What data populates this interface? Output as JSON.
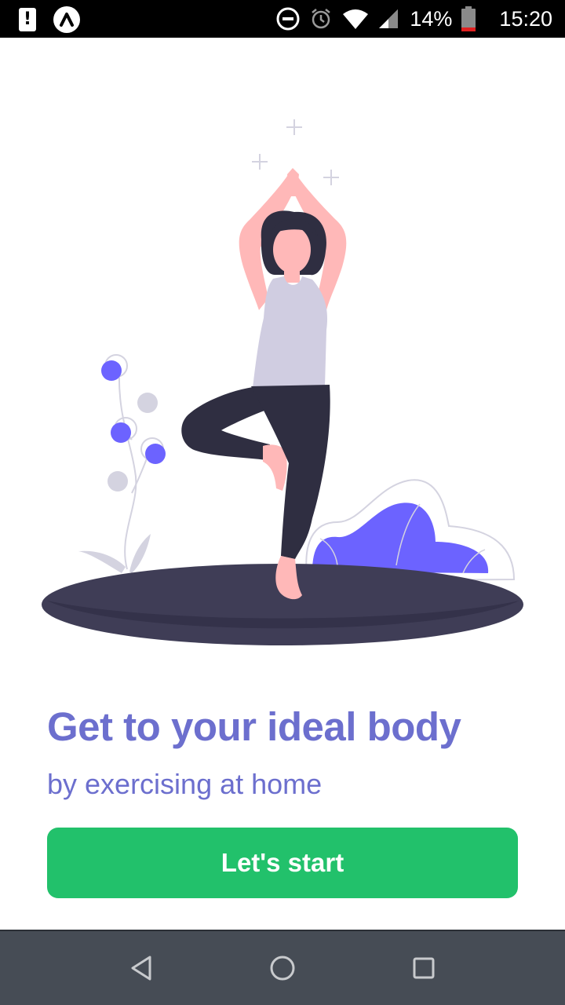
{
  "status_bar": {
    "alert_icon": "exclamation-icon",
    "app_icon": "app-logo-icon",
    "icons": [
      "do-not-disturb-icon",
      "alarm-icon",
      "wifi-icon",
      "cell-signal-icon"
    ],
    "battery_percent": "14%",
    "battery_icon": "battery-low-icon",
    "time": "15:20"
  },
  "onboarding": {
    "illustration": "woman-yoga-tree-pose-illustration",
    "headline": "Get to your ideal body",
    "subheadline": "by exercising at home",
    "start_label": "Let's start"
  },
  "nav_bar": {
    "back_icon": "back-triangle-icon",
    "home_icon": "home-circle-icon",
    "recents_icon": "recents-square-icon"
  },
  "colors": {
    "accent_text": "#6c6fce",
    "primary_button": "#22c16b",
    "illustration_purple": "#6c63ff",
    "ground": "#3f3d56",
    "nav_bar": "#464c55"
  }
}
